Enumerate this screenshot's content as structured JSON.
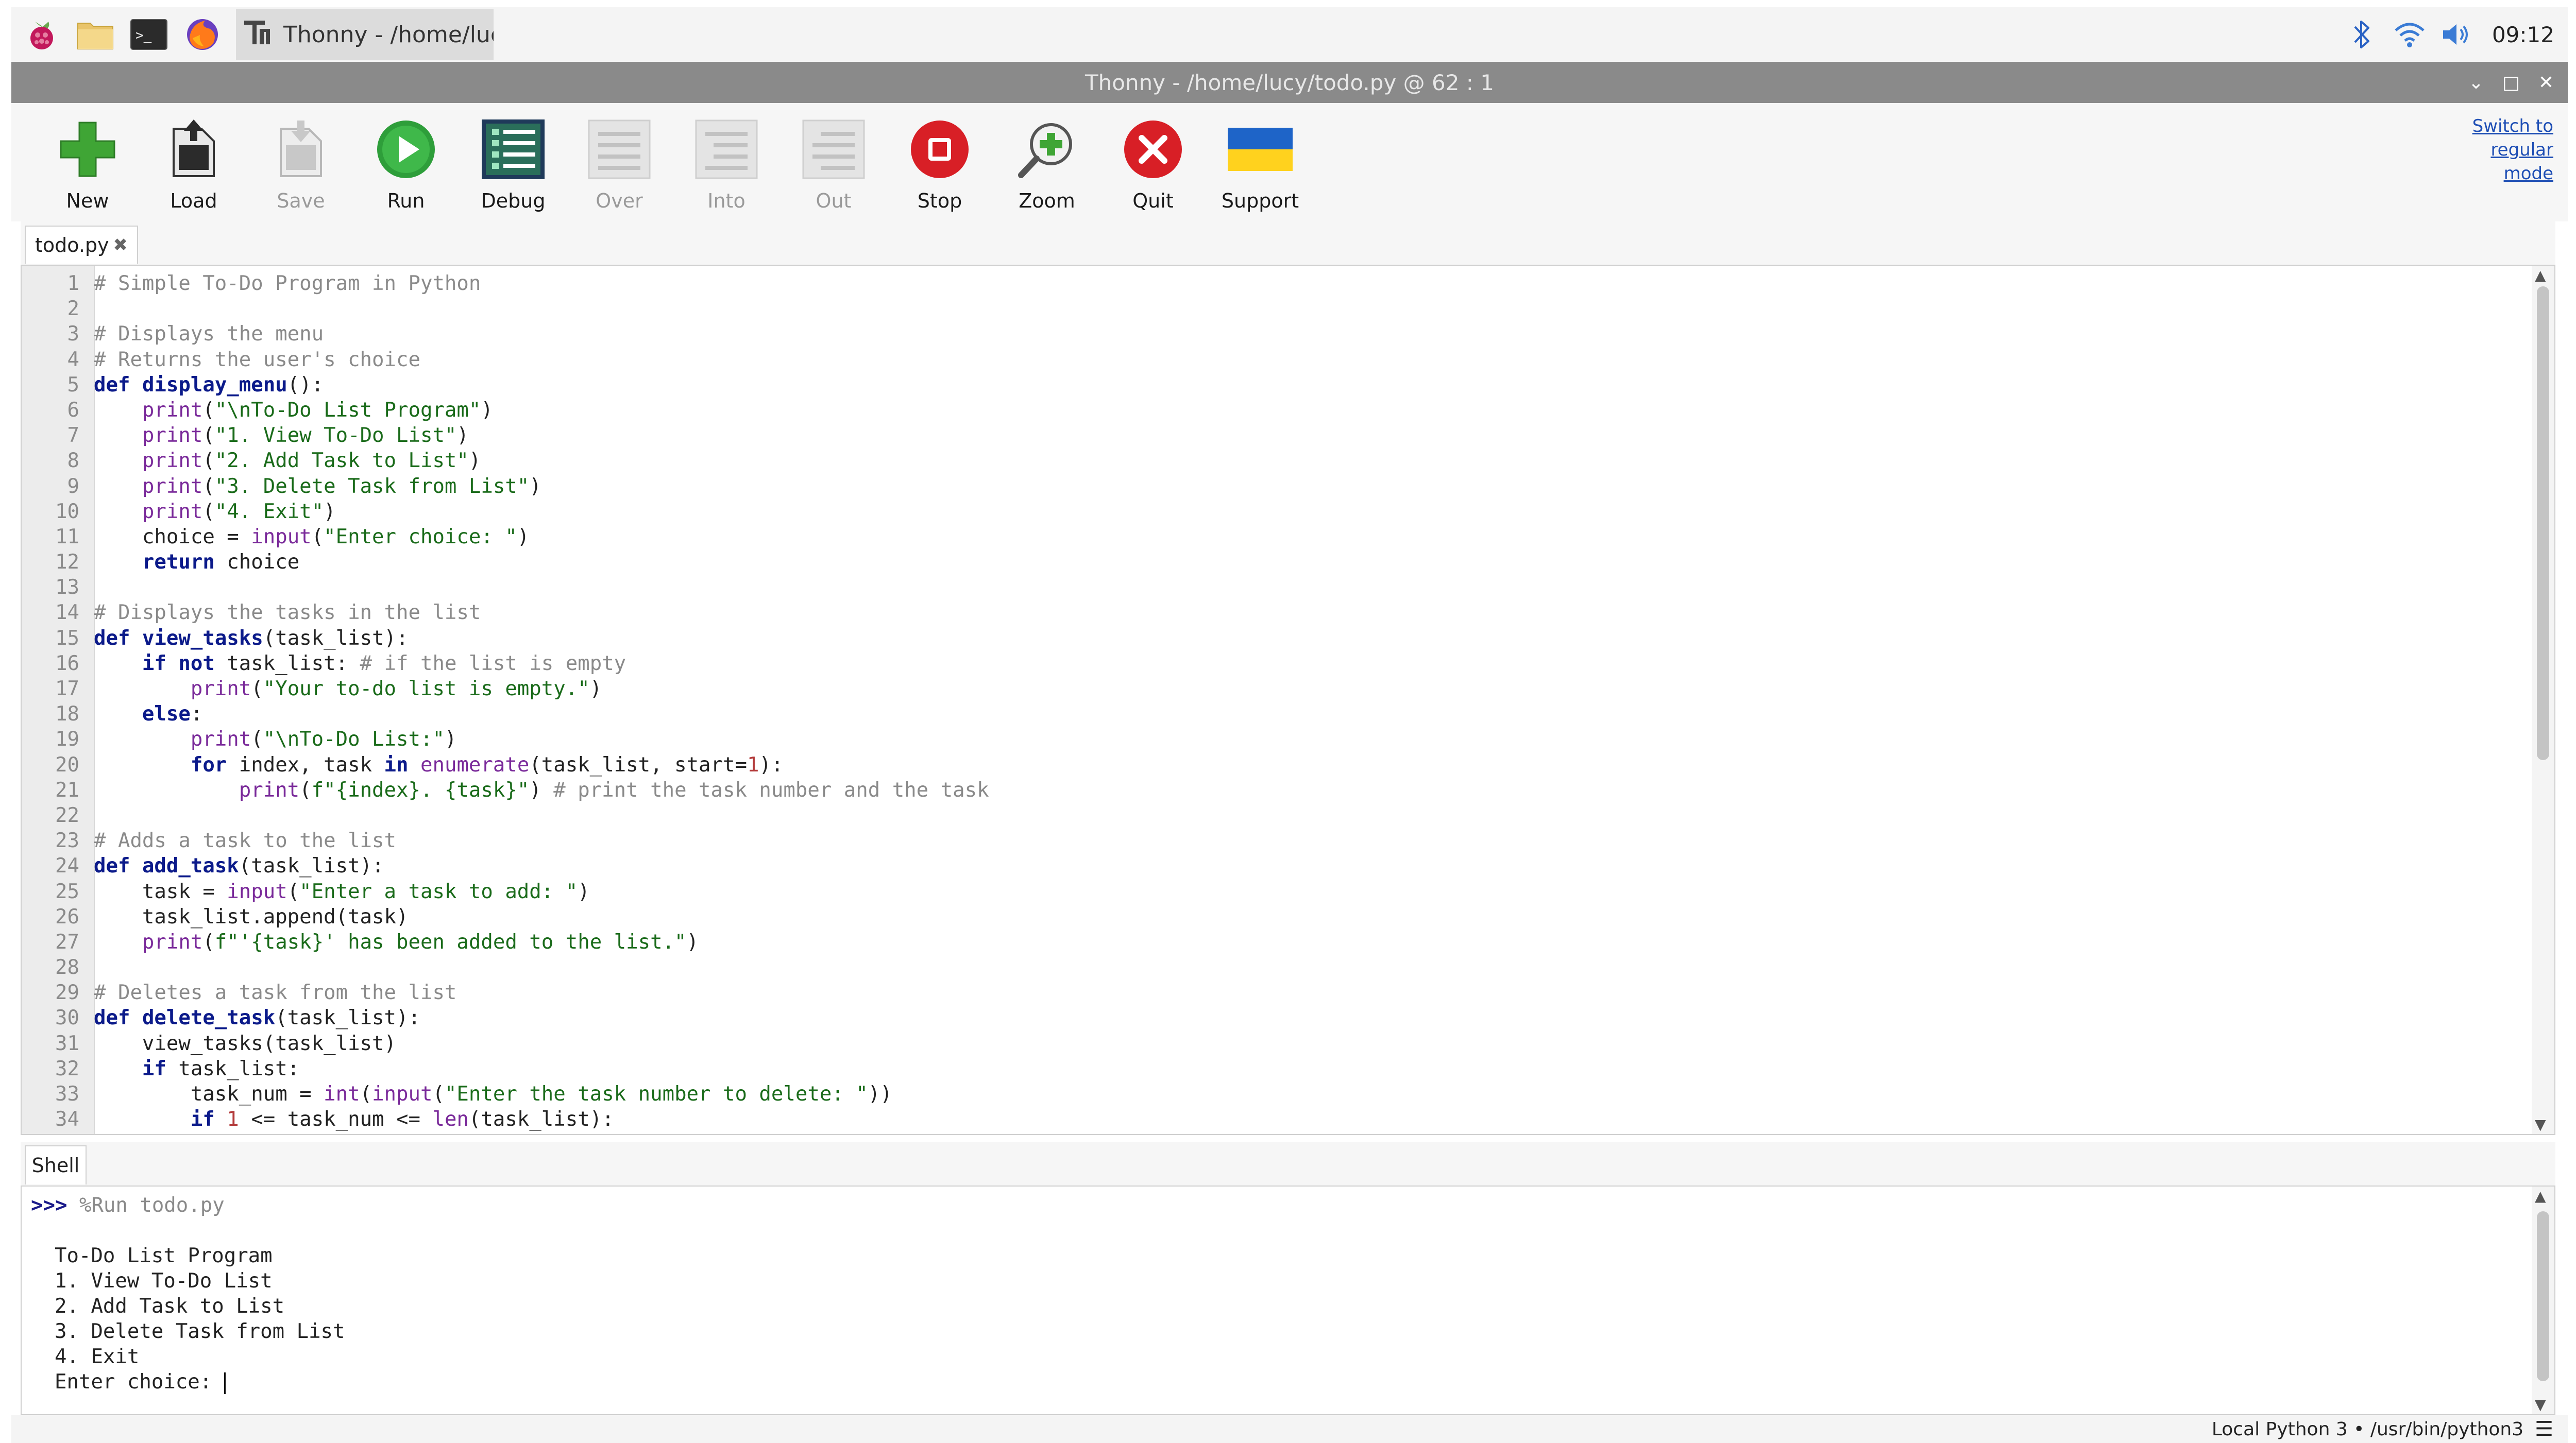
{
  "taskbar": {
    "window_title": "Thonny - /home/luc.."
  },
  "titlebar": {
    "title": "Thonny - /home/lucy/todo.py @ 62 : 1"
  },
  "tray": {
    "time": "09:12"
  },
  "toolbar": {
    "new": "New",
    "load": "Load",
    "save": "Save",
    "run": "Run",
    "debug": "Debug",
    "over": "Over",
    "into": "Into",
    "out": "Out",
    "stop": "Stop",
    "zoom": "Zoom",
    "quit": "Quit",
    "support": "Support",
    "switch_mode": "Switch to regular mode"
  },
  "editor": {
    "tab_label": "todo.py",
    "lines": [
      "# Simple To-Do Program in Python",
      "",
      "# Displays the menu",
      "# Returns the user's choice",
      "def display_menu():",
      "    print(\"\\nTo-Do List Program\")",
      "    print(\"1. View To-Do List\")",
      "    print(\"2. Add Task to List\")",
      "    print(\"3. Delete Task from List\")",
      "    print(\"4. Exit\")",
      "    choice = input(\"Enter choice: \")",
      "    return choice",
      "",
      "# Displays the tasks in the list",
      "def view_tasks(task_list):",
      "    if not task_list: # if the list is empty",
      "        print(\"Your to-do list is empty.\")",
      "    else:",
      "        print(\"\\nTo-Do List:\")",
      "        for index, task in enumerate(task_list, start=1):",
      "            print(f\"{index}. {task}\") # print the task number and the task",
      "",
      "# Adds a task to the list",
      "def add_task(task_list):",
      "    task = input(\"Enter a task to add: \")",
      "    task_list.append(task)",
      "    print(f\"'{task}' has been added to the list.\")",
      "",
      "# Deletes a task from the list",
      "def delete_task(task_list):",
      "    view_tasks(task_list)",
      "    if task_list:",
      "        task_num = int(input(\"Enter the task number to delete: \"))",
      "        if 1 <= task_num <= len(task_list):"
    ]
  },
  "shell": {
    "tab_label": "Shell",
    "prompt": ">>>",
    "command": "%Run todo.py",
    "output": [
      "",
      "To-Do List Program",
      "1. View To-Do List",
      "2. Add Task to List",
      "3. Delete Task from List",
      "4. Exit"
    ],
    "input_prompt": "Enter choice: "
  },
  "status": {
    "interpreter": "Local Python 3 • /usr/bin/python3"
  }
}
